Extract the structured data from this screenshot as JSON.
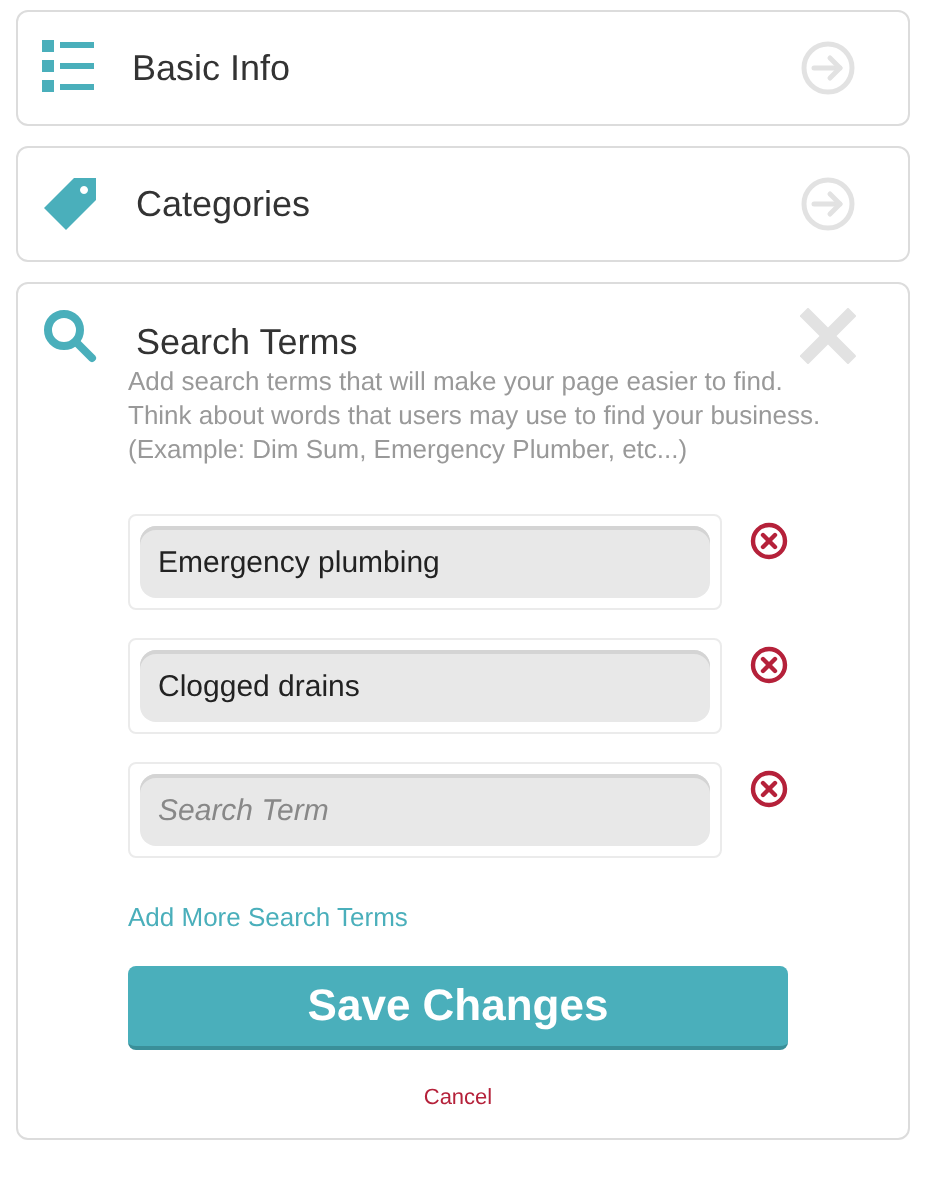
{
  "sections": [
    {
      "title": "Basic Info",
      "expanded": false
    },
    {
      "title": "Categories",
      "expanded": false
    },
    {
      "title": "Search Terms",
      "expanded": true,
      "description": "Add search terms that will make your page easier to find. Think about words that users may use to find your business. (Example: Dim Sum, Emergency Plumber, etc...)",
      "terms": [
        {
          "value": "Emergency plumbing"
        },
        {
          "value": "Clogged drains"
        },
        {
          "placeholder": "Search Term"
        }
      ],
      "add_link": "Add More Search Terms",
      "save_button": "Save Changes",
      "cancel_link": "Cancel"
    }
  ]
}
